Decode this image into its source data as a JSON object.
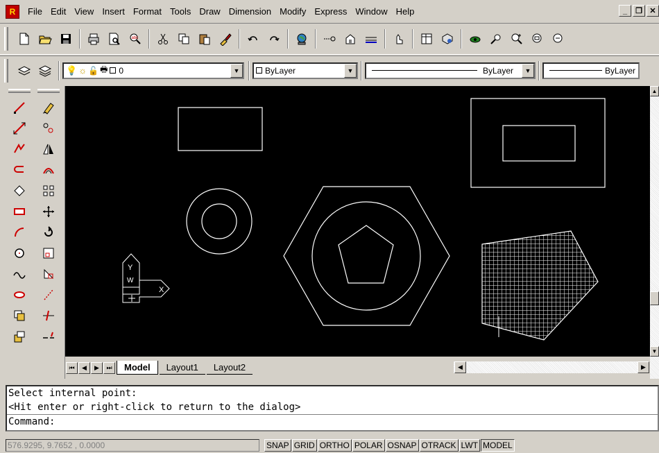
{
  "app": {
    "icon_text": "R"
  },
  "menu": {
    "items": [
      "File",
      "Edit",
      "View",
      "Insert",
      "Format",
      "Tools",
      "Draw",
      "Dimension",
      "Modify",
      "Express",
      "Window",
      "Help"
    ]
  },
  "window_controls": {
    "minimize": "_",
    "restore": "❐",
    "close": "✕"
  },
  "layer_toolbar": {
    "layer_value": "0",
    "color_value": "ByLayer",
    "linetype_value": "ByLayer",
    "lineweight_value": "ByLayer"
  },
  "tabs": [
    {
      "label": "Model",
      "active": true
    },
    {
      "label": "Layout1",
      "active": false
    },
    {
      "label": "Layout2",
      "active": false
    }
  ],
  "command_window": {
    "line1": "Select internal point:",
    "line2": "<Hit enter or right-click to return to the dialog>",
    "prompt": "Command:"
  },
  "status": {
    "coords": "576.9295, 9.7652 , 0.0000",
    "toggles": [
      {
        "label": "SNAP",
        "on": false
      },
      {
        "label": "GRID",
        "on": false
      },
      {
        "label": "ORTHO",
        "on": false
      },
      {
        "label": "POLAR",
        "on": false
      },
      {
        "label": "OSNAP",
        "on": false
      },
      {
        "label": "OTRACK",
        "on": false
      },
      {
        "label": "LWT",
        "on": false
      },
      {
        "label": "MODEL",
        "on": true
      }
    ]
  },
  "ucs_icon": {
    "x_label": "X",
    "y_label": "Y",
    "w_label": "W"
  },
  "colors": {
    "background": "#000000",
    "geometry": "#ffffff",
    "chrome": "#d4d0c8",
    "menu_highlight": "#0a246a"
  }
}
